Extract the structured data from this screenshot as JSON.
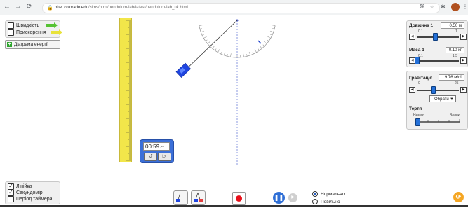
{
  "browser": {
    "url_domain": "phet.colorado.edu",
    "url_path": "/sims/html/pendulum-lab/latest/pendulum-lab_uk.html"
  },
  "vectors_panel": {
    "velocity_label": "Швидкість",
    "acceleration_label": "Прискорення"
  },
  "energy_button_label": "Діаграма енергії",
  "stopwatch": {
    "time": "00:59",
    "unit": "ст"
  },
  "length_control": {
    "title": "Довжина 1",
    "value": "0.50 м",
    "min": "0.1",
    "max": "1",
    "level": 0.44
  },
  "mass_control": {
    "title": "Маса 1",
    "value": "0.10 кг",
    "min": "0.1",
    "max": "1.5",
    "level": 0.0
  },
  "gravity_control": {
    "title": "Гравітація",
    "value": "9.76 м/с²",
    "min": "0",
    "max": "25",
    "level": 0.39,
    "select_label": "Обрати"
  },
  "friction_control": {
    "title": "Тертя",
    "min_label": "Немає",
    "max_label": "Велик",
    "level": 0.0
  },
  "tools_panel": {
    "ruler_label": "Лінійка",
    "stopwatch_label": "Секундомір",
    "period_timer_label": "Період таймера"
  },
  "speed": {
    "normal_label": "Нормально",
    "slow_label": "Повільно"
  },
  "colors": {
    "ruler": "#f2e64a",
    "slider_thumb": "#2470d8",
    "record": "#e8101a",
    "pendulum_bob": "#1f45e0"
  }
}
